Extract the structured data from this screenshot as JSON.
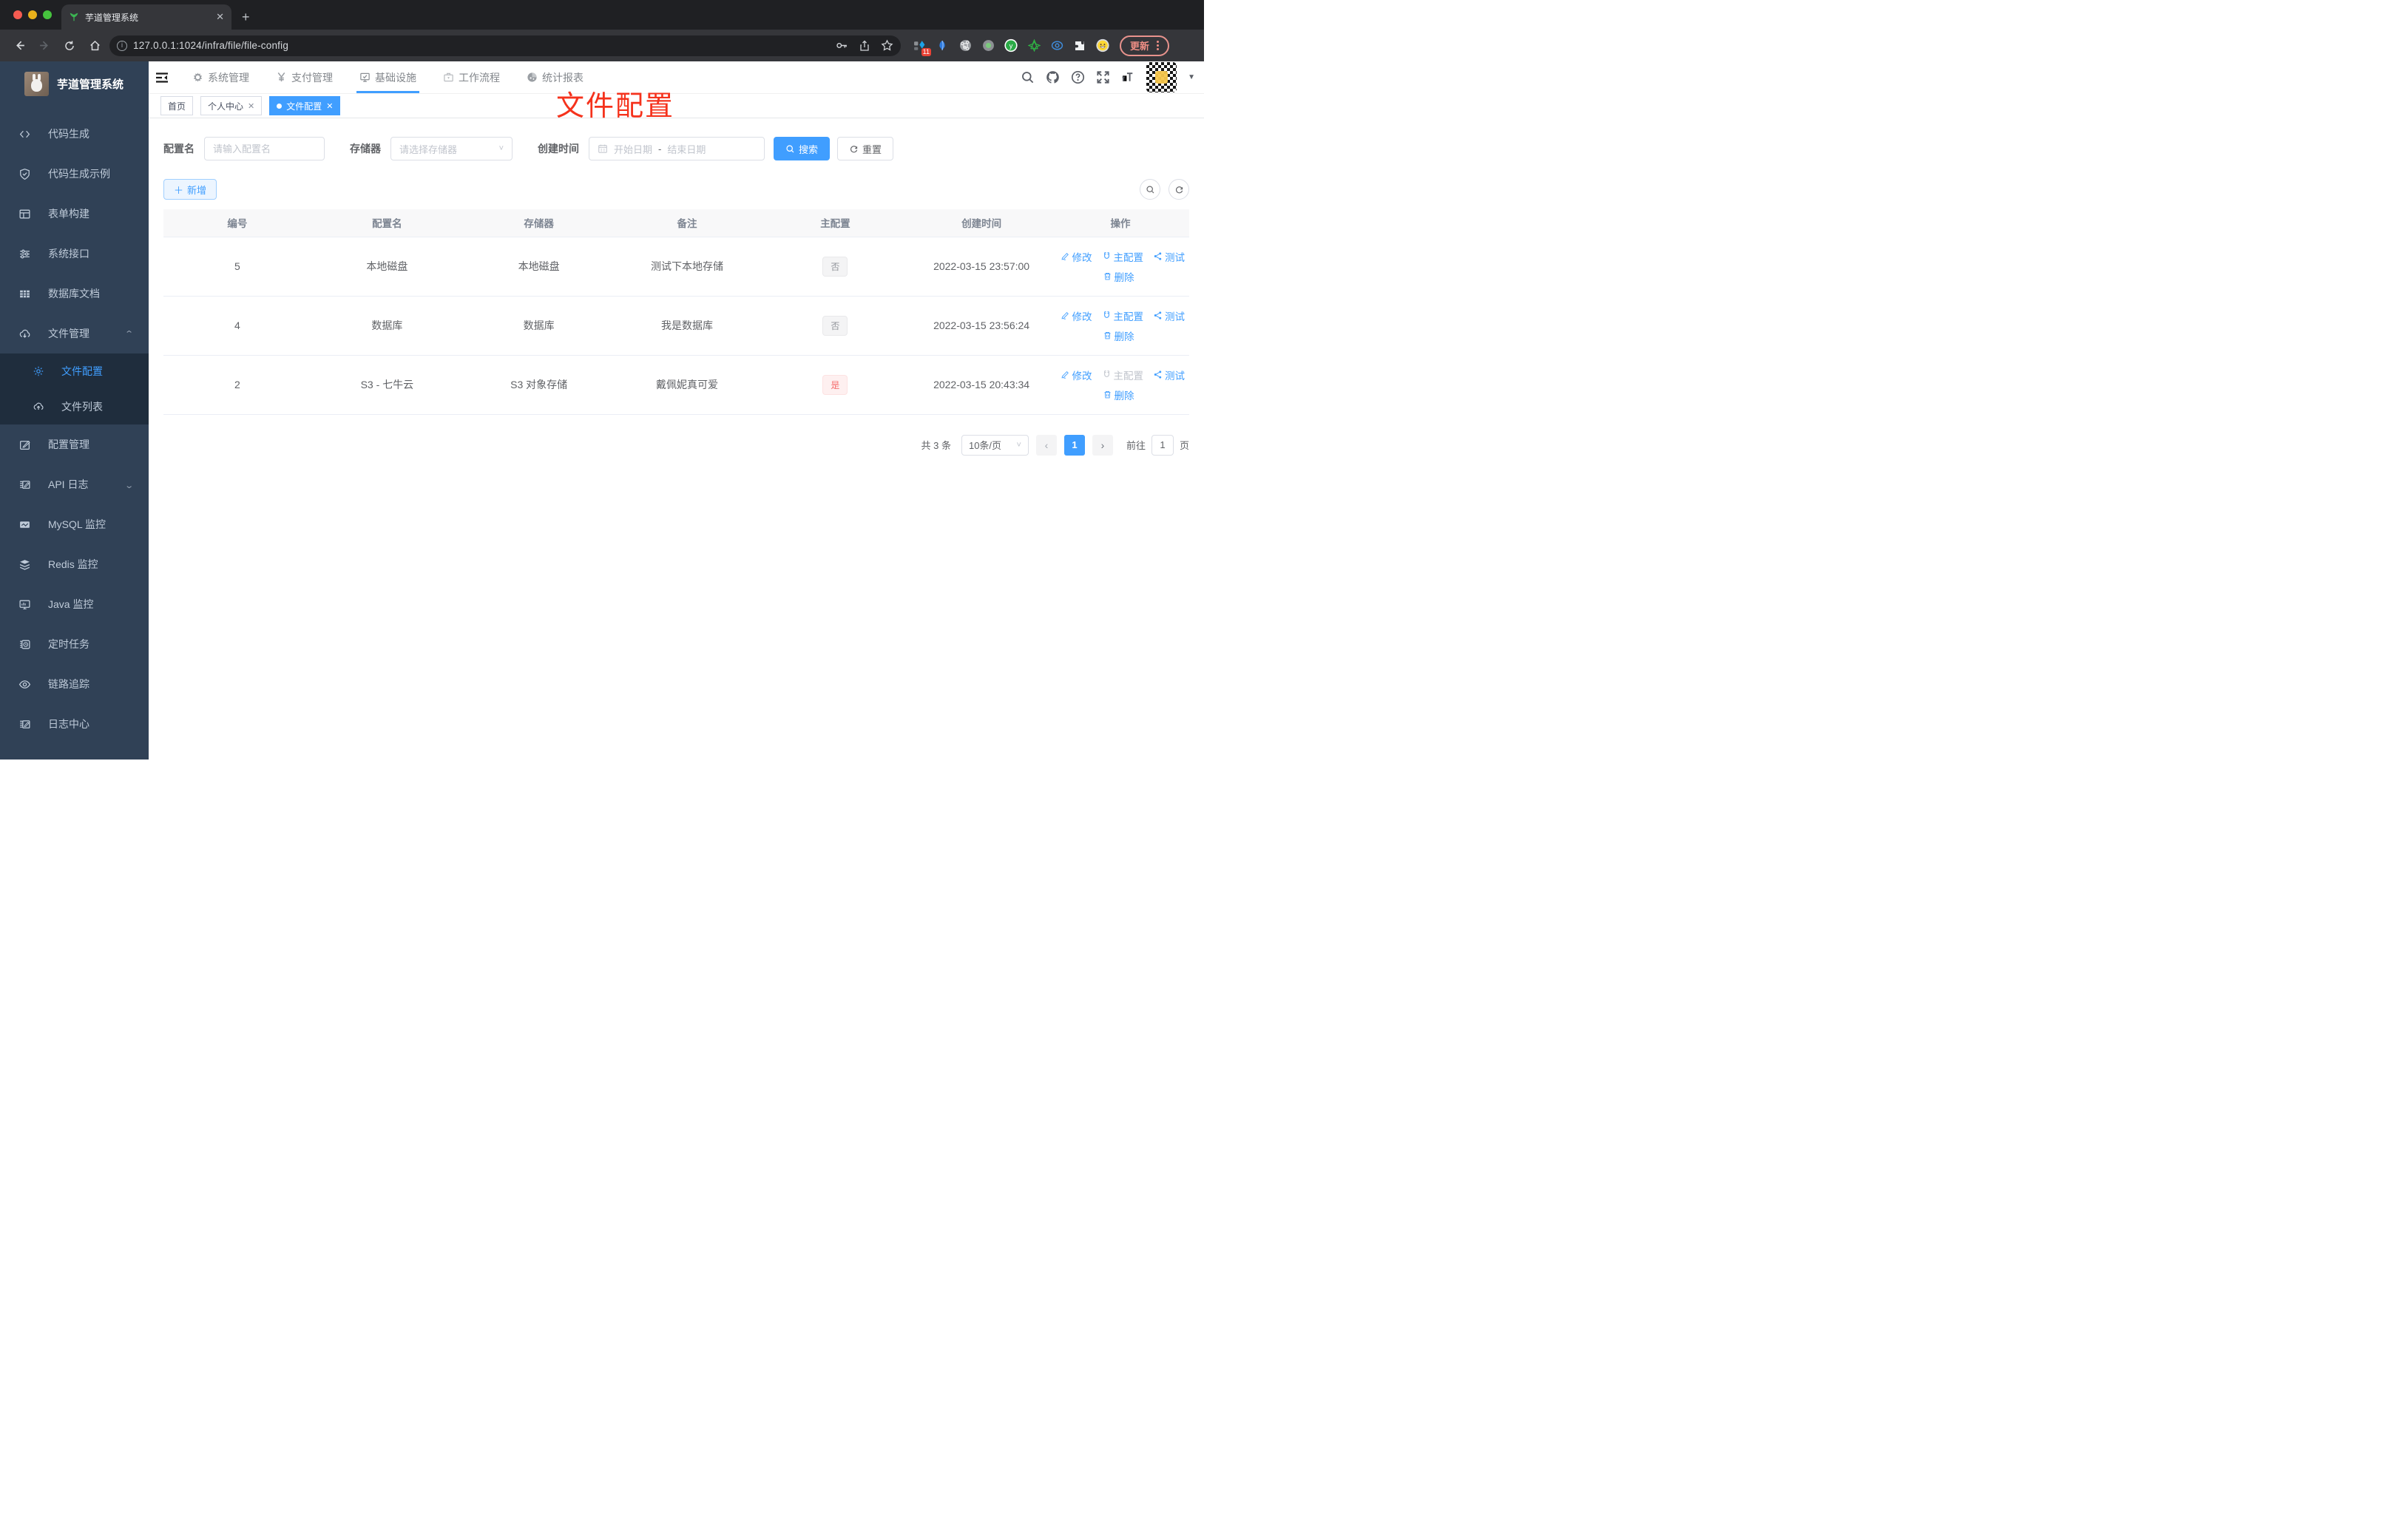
{
  "browser": {
    "tab_title": "芋道管理系统",
    "url": "127.0.0.1:1024/infra/file/file-config",
    "update_button": "更新",
    "extension_badge": "11"
  },
  "sidebar": {
    "title": "芋道管理系统",
    "items": [
      {
        "label": "代码生成"
      },
      {
        "label": "代码生成示例"
      },
      {
        "label": "表单构建"
      },
      {
        "label": "系统接口"
      },
      {
        "label": "数据库文档"
      },
      {
        "label": "文件管理"
      }
    ],
    "file_submenu": [
      {
        "label": "文件配置"
      },
      {
        "label": "文件列表"
      }
    ],
    "items_lower": [
      {
        "label": "配置管理"
      },
      {
        "label": "API 日志"
      },
      {
        "label": "MySQL 监控"
      },
      {
        "label": "Redis 监控"
      },
      {
        "label": "Java 监控"
      },
      {
        "label": "定时任务"
      },
      {
        "label": "链路追踪"
      },
      {
        "label": "日志中心"
      }
    ]
  },
  "topnav": {
    "items": [
      "系统管理",
      "支付管理",
      "基础设施",
      "工作流程",
      "统计报表"
    ]
  },
  "tags": [
    {
      "label": "首页"
    },
    {
      "label": "个人中心"
    },
    {
      "label": "文件配置"
    }
  ],
  "annotation": "文件配置",
  "filters": {
    "name_label": "配置名",
    "name_placeholder": "请输入配置名",
    "storage_label": "存储器",
    "storage_placeholder": "请选择存储器",
    "date_label": "创建时间",
    "date_start_placeholder": "开始日期",
    "date_separator": "-",
    "date_end_placeholder": "结束日期",
    "search_label": "搜索",
    "reset_label": "重置",
    "add_label": "新增"
  },
  "table": {
    "columns": [
      "编号",
      "配置名",
      "存储器",
      "备注",
      "主配置",
      "创建时间",
      "操作"
    ],
    "actions": {
      "edit": "修改",
      "master": "主配置",
      "test": "测试",
      "delete": "删除"
    },
    "rows": [
      {
        "id": "5",
        "name": "本地磁盘",
        "storage": "本地磁盘",
        "remark": "测试下本地存储",
        "primary": "否",
        "primary_type": "info",
        "created": "2022-03-15 23:57:00",
        "master_disabled": false
      },
      {
        "id": "4",
        "name": "数据库",
        "storage": "数据库",
        "remark": "我是数据库",
        "primary": "否",
        "primary_type": "info",
        "created": "2022-03-15 23:56:24",
        "master_disabled": false
      },
      {
        "id": "2",
        "name": "S3 - 七牛云",
        "storage": "S3 对象存储",
        "remark": "戴佩妮真可爱",
        "primary": "是",
        "primary_type": "danger",
        "created": "2022-03-15 20:43:34",
        "master_disabled": true
      }
    ]
  },
  "pagination": {
    "total": "共 3 条",
    "page_size": "10条/页",
    "current": "1",
    "goto_label": "前往",
    "goto_value": "1",
    "page_unit": "页"
  }
}
